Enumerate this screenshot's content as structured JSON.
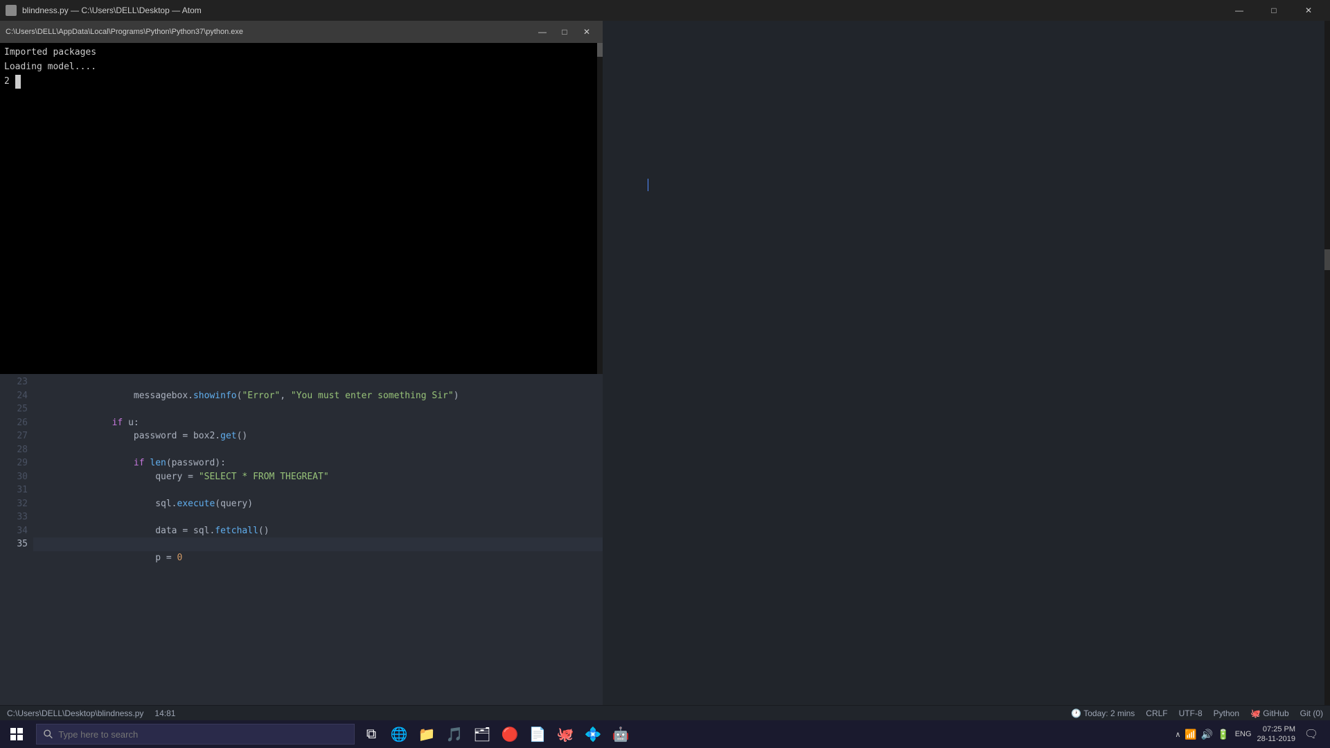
{
  "title_bar": {
    "title": "blindness.py — C:\\Users\\DELL\\Desktop — Atom",
    "controls": {
      "minimize": "—",
      "maximize": "□",
      "close": "✕"
    }
  },
  "terminal": {
    "title_path": "C:\\Users\\DELL\\AppData\\Local\\Programs\\Python\\Python37\\python.exe",
    "output_lines": [
      "Imported packages",
      "Loading model...."
    ],
    "cursor_line": "2 ▌",
    "controls": {
      "minimize": "—",
      "maximize": "□",
      "close": "✕"
    }
  },
  "code_editor": {
    "line_numbers": [
      23,
      24,
      25,
      26,
      27,
      28,
      29,
      30,
      31,
      32,
      33,
      34,
      35
    ],
    "code_lines": [
      {
        "num": 23,
        "content": "        messagebox.showinfo(\"Error\", \"You must enter something Sir\")",
        "active": false
      },
      {
        "num": 24,
        "content": "",
        "active": false
      },
      {
        "num": 25,
        "content": "    if u:",
        "active": false
      },
      {
        "num": 26,
        "content": "        password = box2.get()",
        "active": false
      },
      {
        "num": 27,
        "content": "",
        "active": false
      },
      {
        "num": 28,
        "content": "        if len(password):",
        "active": false
      },
      {
        "num": 29,
        "content": "            query = \"SELECT * FROM THEGREAT\"",
        "active": false
      },
      {
        "num": 30,
        "content": "",
        "active": false
      },
      {
        "num": 31,
        "content": "            sql.execute(query)",
        "active": false
      },
      {
        "num": 32,
        "content": "",
        "active": false
      },
      {
        "num": 33,
        "content": "            data = sql.fetchall()",
        "active": false
      },
      {
        "num": 34,
        "content": "",
        "active": false
      },
      {
        "num": 35,
        "content": "            p = 0",
        "active": true
      }
    ]
  },
  "status_bar": {
    "file_path": "C:\\Users\\DELL\\Desktop\\blindness.py",
    "cursor_pos": "14:81",
    "notification": "Today: 2 mins",
    "line_ending": "CRLF",
    "encoding": "UTF-8",
    "language": "Python",
    "github": "GitHub",
    "git": "Git (0)"
  },
  "taskbar": {
    "search_placeholder": "Type here to search",
    "apps": [
      {
        "name": "task-view",
        "icon": "⧉"
      },
      {
        "name": "edge-browser",
        "icon": "⬡"
      },
      {
        "name": "file-explorer",
        "icon": "📁"
      },
      {
        "name": "spotify",
        "icon": "🎵"
      },
      {
        "name": "file-explorer2",
        "icon": "🗂"
      },
      {
        "name": "app6",
        "icon": "🔴"
      },
      {
        "name": "adobe",
        "icon": "📄"
      },
      {
        "name": "github-desktop",
        "icon": "🐙"
      },
      {
        "name": "app9",
        "icon": "💠"
      },
      {
        "name": "app10",
        "icon": "🤖"
      }
    ],
    "sys_icons": {
      "show_hidden": "∧",
      "network": "WiFi",
      "sound": "🔊",
      "battery": "🔋",
      "language": "ENG"
    },
    "clock": {
      "time": "07:25 PM",
      "date": "28-11-2019"
    },
    "notification_icon": "🗨"
  }
}
